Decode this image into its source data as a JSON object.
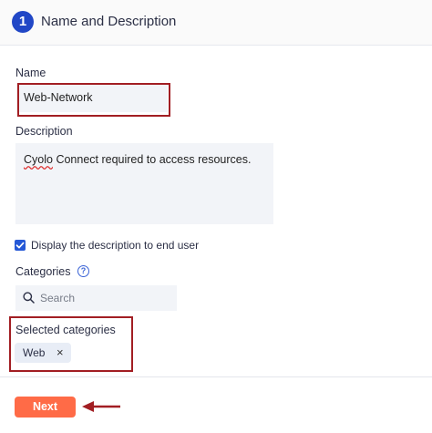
{
  "header": {
    "step_number": "1",
    "title": "Name and Description"
  },
  "form": {
    "name_label": "Name",
    "name_value": "Web-Network",
    "description_label": "Description",
    "description_first_word": "Cyolo",
    "description_rest": " Connect required to access resources.",
    "display_description_checked": true,
    "display_description_label": "Display the description to end user",
    "categories_label": "Categories",
    "help_glyph": "?",
    "search_placeholder": "Search",
    "selected_categories_label": "Selected categories",
    "selected_categories": [
      {
        "label": "Web",
        "remove_glyph": "×"
      }
    ]
  },
  "footer": {
    "next_label": "Next"
  },
  "colors": {
    "accent": "#2147c6",
    "highlight": "#a21e23",
    "primary_button": "#ff6b47",
    "field_bg": "#f2f4f8"
  },
  "icons": [
    "step-number-badge",
    "help-circle-icon",
    "search-icon",
    "check-icon",
    "remove-chip-icon",
    "arrow-left-icon"
  ]
}
